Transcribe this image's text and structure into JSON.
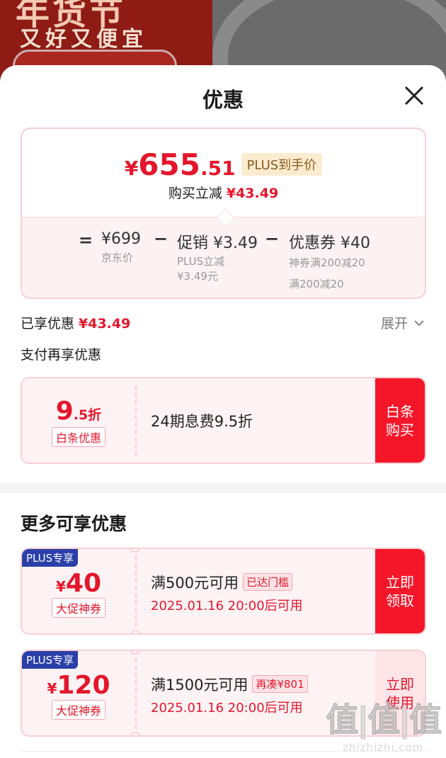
{
  "background": {
    "banner_title": "年货节",
    "banner_sub": "又好又便宜"
  },
  "sheet": {
    "title": "优惠"
  },
  "price_card": {
    "yen": "¥",
    "price_int": "655",
    "price_dec": ".51",
    "plus_label": "PLUS到手价",
    "reduce_label": "购买立减",
    "reduce_value": "¥43.49",
    "equals": "=",
    "minus": "−",
    "jd_price": "¥699",
    "jd_price_label": "京东价",
    "promo": "促销 ¥3.49",
    "promo_sub": "PLUS立减",
    "promo_sub2": "¥3.49元",
    "coupon": "优惠券 ¥40",
    "coupon_sub": "神券满200减20",
    "coupon_sub2": "满200减20"
  },
  "enjoyed": {
    "label": "已享优惠",
    "value": "¥43.49",
    "expand": "展开"
  },
  "pay_title": "支付再享优惠",
  "baitiao": {
    "amount": "9",
    "amount_dec": ".5折",
    "label": "白条优惠",
    "desc": "24期息费9.5折",
    "button": "白条\n购买"
  },
  "more_title": "更多可享优惠",
  "coupons": [
    {
      "badge": "PLUS专享",
      "yen": "¥",
      "amount": "40",
      "label": "大促神券",
      "cond": "满500元可用",
      "tag": "已达门槛",
      "time": "2025.01.16 20:00后可用",
      "button": "立即\n领取"
    },
    {
      "badge": "PLUS专享",
      "yen": "¥",
      "amount": "120",
      "label": "大促神券",
      "cond": "满1500元可用",
      "tag": "再凑¥801",
      "time": "2025.01.16 20:00后可用",
      "button": "立即\n使用"
    }
  ],
  "watermark": {
    "big": "值|值|值",
    "small": "zhizhizhi.com"
  },
  "colors": {
    "accent_red": "#e4162b",
    "plus_blue": "#2a3fa8",
    "plus_gold_bg": "#fbecd0"
  }
}
